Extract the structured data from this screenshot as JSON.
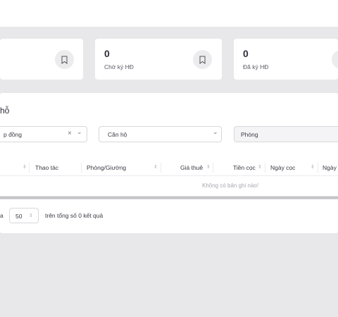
{
  "cards": [
    {
      "value": "0",
      "label": "Chờ ký HĐ",
      "icon": "bookmark-icon"
    },
    {
      "value": "0",
      "label": "Đã ký HĐ",
      "icon": "bookmark-icon"
    }
  ],
  "panel": {
    "title": "hỗ"
  },
  "filters": {
    "contract_select": "p đồng",
    "contract_clear": "×",
    "apartment_select": "Căn hộ",
    "room_placeholder": "Phòng",
    "chevron": "⌄"
  },
  "table": {
    "headers": [
      "Thao tác",
      "Phòng/Giường",
      "Giá thuê",
      "Tiền cọc",
      "Ngày cọc",
      "Ngày"
    ],
    "sort_glyph": "⇕",
    "empty_text": "Không có bản ghi nào!"
  },
  "pagination": {
    "prefix": "a",
    "page_size": "50",
    "total_text": "trên tổng số 0 kết quả"
  }
}
